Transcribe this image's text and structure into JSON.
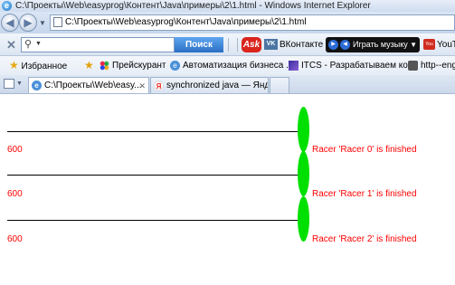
{
  "window": {
    "title": "C:\\Проекты\\Web\\easyprog\\Контент\\Java\\примеры\\2\\1.html - Windows Internet Explorer"
  },
  "address_bar": {
    "url": "C:\\Проекты\\Web\\easyprog\\Контент\\Java\\примеры\\2\\1.html"
  },
  "toolbar": {
    "search_value": "",
    "search_button": "Поиск",
    "ask_label": "Ask",
    "vk_icon": "VK",
    "vk_label": "ВКонтакте",
    "music_label": "Играть музыку",
    "youtube_icon": "You",
    "youtube_label": "YouT"
  },
  "favorites": {
    "label": "Избранное",
    "items": [
      {
        "label": "Прейскурант",
        "icon": "colored-dots-icon"
      },
      {
        "label": "Автоматизация бизнеса ...",
        "icon": "ie-page-icon"
      },
      {
        "label": "ITCS - Разрабатываем ко...",
        "icon": "itcs-icon"
      },
      {
        "label": "http--eng",
        "icon": "camera-icon"
      }
    ]
  },
  "tabs": [
    {
      "label": "C:\\Проекты\\Web\\easy...",
      "active": true
    },
    {
      "label": "synchronized java — Янде...",
      "active": false
    }
  ],
  "racers": [
    {
      "value": "600",
      "message": "Racer 'Racer 0' is finished"
    },
    {
      "value": "600",
      "message": "Racer 'Racer 1' is finished"
    },
    {
      "value": "600",
      "message": "Racer 'Racer 2' is finished"
    }
  ],
  "colors": {
    "racer_fill": "#00e000",
    "text_red": "#ff0000",
    "track_line": "#000000"
  }
}
